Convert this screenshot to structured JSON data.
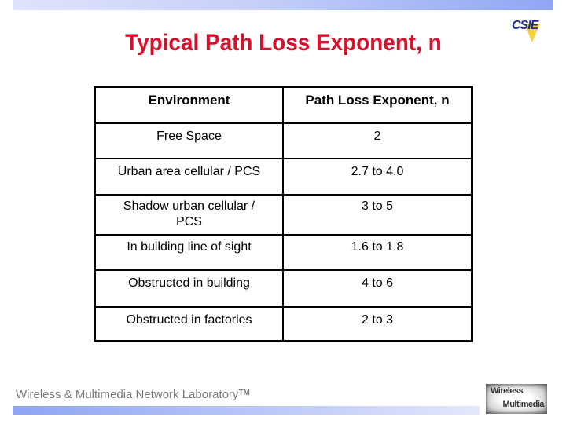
{
  "slide": {
    "title": "Typical Path Loss Exponent, n",
    "logo_top_right": "CSIE",
    "footer_text": "Wireless & Multimedia Network Laboratory",
    "footer_trademark": "TM",
    "logo_bottom_right": {
      "line1": "Wireless",
      "line2": "Multimedia"
    },
    "colors": {
      "title": "#d9102b",
      "band_light": "#dfe3fb",
      "band_dark": "#8fa6f4",
      "footer_text": "#7b7b7b"
    }
  },
  "table": {
    "headers": [
      "Environment",
      "Path Loss Exponent, n"
    ],
    "rows": [
      [
        "Free Space",
        "2"
      ],
      [
        "Urban area cellular / PCS",
        "2.7 to 4.0"
      ],
      [
        "Shadow urban cellular / PCS",
        "3 to 5"
      ],
      [
        "In building line of sight",
        "1.6 to 1.8"
      ],
      [
        "Obstructed in building",
        "4 to 6"
      ],
      [
        "Obstructed in factories",
        "2 to 3"
      ]
    ]
  }
}
